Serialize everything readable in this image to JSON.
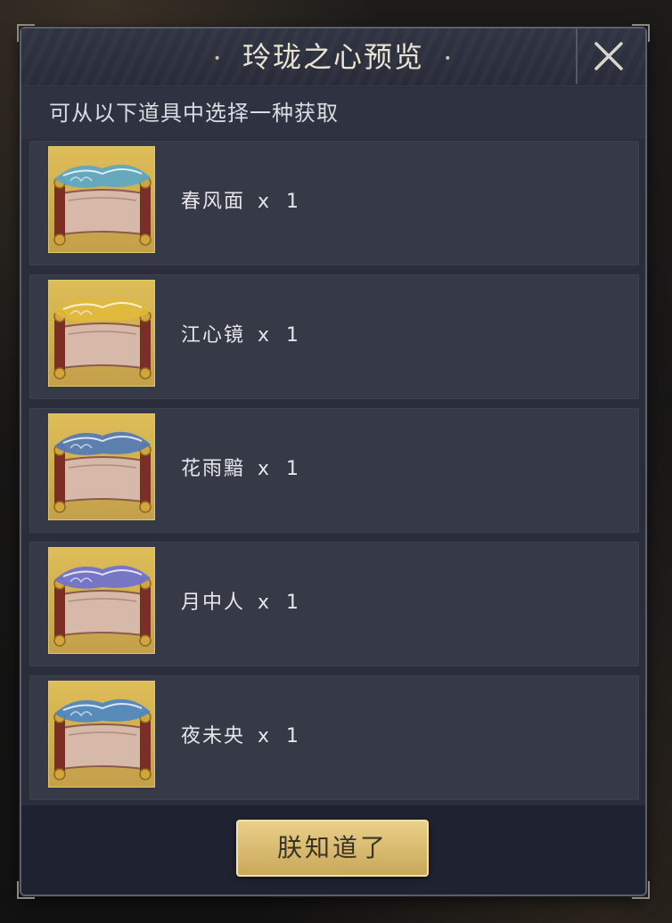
{
  "dialog": {
    "title": "玲珑之心预览",
    "title_dot": "•",
    "close_icon": "close-icon",
    "subtitle": "可从以下道具中选择一种获取"
  },
  "items": [
    {
      "name": "春风面",
      "qty": "x 1",
      "accent": "#5aa6c8",
      "icon": "scroll-chunfengmian-icon"
    },
    {
      "name": "江心镜",
      "qty": "x 1",
      "accent": "#e2b93b",
      "icon": "scroll-jiangxinjing-icon"
    },
    {
      "name": "花雨黯",
      "qty": "x 1",
      "accent": "#4f79b8",
      "icon": "scroll-huayuan-icon"
    },
    {
      "name": "月中人",
      "qty": "x 1",
      "accent": "#6b6fd1",
      "icon": "scroll-yuezhongren-icon"
    },
    {
      "name": "夜未央",
      "qty": "x 1",
      "accent": "#4a86c4",
      "icon": "scroll-yeweiyang-icon"
    }
  ],
  "footer": {
    "confirm_label": "朕知道了"
  },
  "colors": {
    "panel": "#2b2e3a",
    "row": "#363946",
    "gold": "#e9cf88"
  }
}
